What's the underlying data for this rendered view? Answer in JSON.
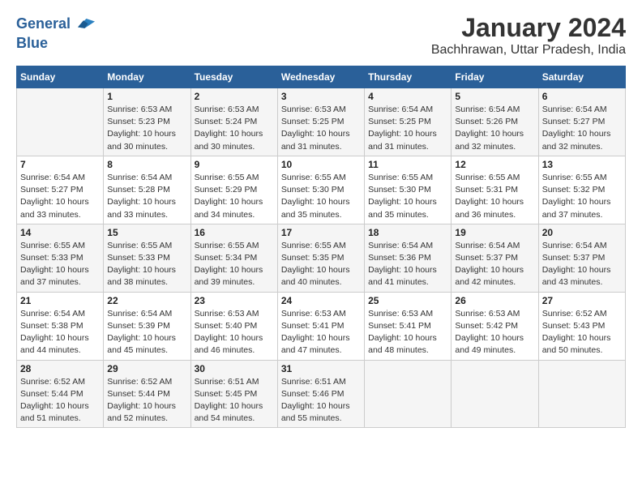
{
  "header": {
    "logo_line1": "General",
    "logo_line2": "Blue",
    "title": "January 2024",
    "subtitle": "Bachhrawan, Uttar Pradesh, India"
  },
  "days_of_week": [
    "Sunday",
    "Monday",
    "Tuesday",
    "Wednesday",
    "Thursday",
    "Friday",
    "Saturday"
  ],
  "weeks": [
    [
      {
        "day": "",
        "info": ""
      },
      {
        "day": "1",
        "info": "Sunrise: 6:53 AM\nSunset: 5:23 PM\nDaylight: 10 hours\nand 30 minutes."
      },
      {
        "day": "2",
        "info": "Sunrise: 6:53 AM\nSunset: 5:24 PM\nDaylight: 10 hours\nand 30 minutes."
      },
      {
        "day": "3",
        "info": "Sunrise: 6:53 AM\nSunset: 5:25 PM\nDaylight: 10 hours\nand 31 minutes."
      },
      {
        "day": "4",
        "info": "Sunrise: 6:54 AM\nSunset: 5:25 PM\nDaylight: 10 hours\nand 31 minutes."
      },
      {
        "day": "5",
        "info": "Sunrise: 6:54 AM\nSunset: 5:26 PM\nDaylight: 10 hours\nand 32 minutes."
      },
      {
        "day": "6",
        "info": "Sunrise: 6:54 AM\nSunset: 5:27 PM\nDaylight: 10 hours\nand 32 minutes."
      }
    ],
    [
      {
        "day": "7",
        "info": "Sunrise: 6:54 AM\nSunset: 5:27 PM\nDaylight: 10 hours\nand 33 minutes."
      },
      {
        "day": "8",
        "info": "Sunrise: 6:54 AM\nSunset: 5:28 PM\nDaylight: 10 hours\nand 33 minutes."
      },
      {
        "day": "9",
        "info": "Sunrise: 6:55 AM\nSunset: 5:29 PM\nDaylight: 10 hours\nand 34 minutes."
      },
      {
        "day": "10",
        "info": "Sunrise: 6:55 AM\nSunset: 5:30 PM\nDaylight: 10 hours\nand 35 minutes."
      },
      {
        "day": "11",
        "info": "Sunrise: 6:55 AM\nSunset: 5:30 PM\nDaylight: 10 hours\nand 35 minutes."
      },
      {
        "day": "12",
        "info": "Sunrise: 6:55 AM\nSunset: 5:31 PM\nDaylight: 10 hours\nand 36 minutes."
      },
      {
        "day": "13",
        "info": "Sunrise: 6:55 AM\nSunset: 5:32 PM\nDaylight: 10 hours\nand 37 minutes."
      }
    ],
    [
      {
        "day": "14",
        "info": "Sunrise: 6:55 AM\nSunset: 5:33 PM\nDaylight: 10 hours\nand 37 minutes."
      },
      {
        "day": "15",
        "info": "Sunrise: 6:55 AM\nSunset: 5:33 PM\nDaylight: 10 hours\nand 38 minutes."
      },
      {
        "day": "16",
        "info": "Sunrise: 6:55 AM\nSunset: 5:34 PM\nDaylight: 10 hours\nand 39 minutes."
      },
      {
        "day": "17",
        "info": "Sunrise: 6:55 AM\nSunset: 5:35 PM\nDaylight: 10 hours\nand 40 minutes."
      },
      {
        "day": "18",
        "info": "Sunrise: 6:54 AM\nSunset: 5:36 PM\nDaylight: 10 hours\nand 41 minutes."
      },
      {
        "day": "19",
        "info": "Sunrise: 6:54 AM\nSunset: 5:37 PM\nDaylight: 10 hours\nand 42 minutes."
      },
      {
        "day": "20",
        "info": "Sunrise: 6:54 AM\nSunset: 5:37 PM\nDaylight: 10 hours\nand 43 minutes."
      }
    ],
    [
      {
        "day": "21",
        "info": "Sunrise: 6:54 AM\nSunset: 5:38 PM\nDaylight: 10 hours\nand 44 minutes."
      },
      {
        "day": "22",
        "info": "Sunrise: 6:54 AM\nSunset: 5:39 PM\nDaylight: 10 hours\nand 45 minutes."
      },
      {
        "day": "23",
        "info": "Sunrise: 6:53 AM\nSunset: 5:40 PM\nDaylight: 10 hours\nand 46 minutes."
      },
      {
        "day": "24",
        "info": "Sunrise: 6:53 AM\nSunset: 5:41 PM\nDaylight: 10 hours\nand 47 minutes."
      },
      {
        "day": "25",
        "info": "Sunrise: 6:53 AM\nSunset: 5:41 PM\nDaylight: 10 hours\nand 48 minutes."
      },
      {
        "day": "26",
        "info": "Sunrise: 6:53 AM\nSunset: 5:42 PM\nDaylight: 10 hours\nand 49 minutes."
      },
      {
        "day": "27",
        "info": "Sunrise: 6:52 AM\nSunset: 5:43 PM\nDaylight: 10 hours\nand 50 minutes."
      }
    ],
    [
      {
        "day": "28",
        "info": "Sunrise: 6:52 AM\nSunset: 5:44 PM\nDaylight: 10 hours\nand 51 minutes."
      },
      {
        "day": "29",
        "info": "Sunrise: 6:52 AM\nSunset: 5:44 PM\nDaylight: 10 hours\nand 52 minutes."
      },
      {
        "day": "30",
        "info": "Sunrise: 6:51 AM\nSunset: 5:45 PM\nDaylight: 10 hours\nand 54 minutes."
      },
      {
        "day": "31",
        "info": "Sunrise: 6:51 AM\nSunset: 5:46 PM\nDaylight: 10 hours\nand 55 minutes."
      },
      {
        "day": "",
        "info": ""
      },
      {
        "day": "",
        "info": ""
      },
      {
        "day": "",
        "info": ""
      }
    ]
  ]
}
